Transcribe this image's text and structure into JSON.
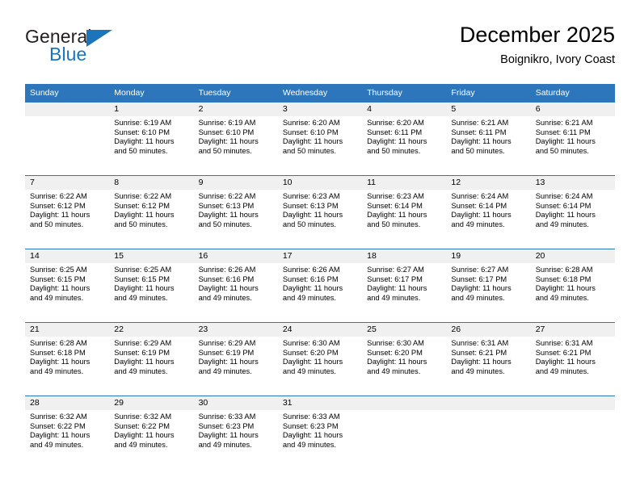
{
  "brand": {
    "name_part1": "General",
    "name_part2": "Blue",
    "triangle_color": "#1b75bb"
  },
  "header": {
    "month_title": "December 2025",
    "location": "Boignikro, Ivory Coast"
  },
  "theme": {
    "header_blue": "#2d76bb",
    "daynum_band": "#f0f0f0",
    "text": "#000000"
  },
  "calendar": {
    "weekday_headers": [
      "Sunday",
      "Monday",
      "Tuesday",
      "Wednesday",
      "Thursday",
      "Friday",
      "Saturday"
    ],
    "weeks": [
      [
        {
          "day": "",
          "sunrise": "",
          "sunset": "",
          "daylight_line1": "",
          "daylight_line2": "",
          "empty": true
        },
        {
          "day": "1",
          "sunrise": "Sunrise: 6:19 AM",
          "sunset": "Sunset: 6:10 PM",
          "daylight_line1": "Daylight: 11 hours",
          "daylight_line2": "and 50 minutes.",
          "empty": false
        },
        {
          "day": "2",
          "sunrise": "Sunrise: 6:19 AM",
          "sunset": "Sunset: 6:10 PM",
          "daylight_line1": "Daylight: 11 hours",
          "daylight_line2": "and 50 minutes.",
          "empty": false
        },
        {
          "day": "3",
          "sunrise": "Sunrise: 6:20 AM",
          "sunset": "Sunset: 6:10 PM",
          "daylight_line1": "Daylight: 11 hours",
          "daylight_line2": "and 50 minutes.",
          "empty": false
        },
        {
          "day": "4",
          "sunrise": "Sunrise: 6:20 AM",
          "sunset": "Sunset: 6:11 PM",
          "daylight_line1": "Daylight: 11 hours",
          "daylight_line2": "and 50 minutes.",
          "empty": false
        },
        {
          "day": "5",
          "sunrise": "Sunrise: 6:21 AM",
          "sunset": "Sunset: 6:11 PM",
          "daylight_line1": "Daylight: 11 hours",
          "daylight_line2": "and 50 minutes.",
          "empty": false
        },
        {
          "day": "6",
          "sunrise": "Sunrise: 6:21 AM",
          "sunset": "Sunset: 6:11 PM",
          "daylight_line1": "Daylight: 11 hours",
          "daylight_line2": "and 50 minutes.",
          "empty": false
        }
      ],
      [
        {
          "day": "7",
          "sunrise": "Sunrise: 6:22 AM",
          "sunset": "Sunset: 6:12 PM",
          "daylight_line1": "Daylight: 11 hours",
          "daylight_line2": "and 50 minutes.",
          "empty": false
        },
        {
          "day": "8",
          "sunrise": "Sunrise: 6:22 AM",
          "sunset": "Sunset: 6:12 PM",
          "daylight_line1": "Daylight: 11 hours",
          "daylight_line2": "and 50 minutes.",
          "empty": false
        },
        {
          "day": "9",
          "sunrise": "Sunrise: 6:22 AM",
          "sunset": "Sunset: 6:13 PM",
          "daylight_line1": "Daylight: 11 hours",
          "daylight_line2": "and 50 minutes.",
          "empty": false
        },
        {
          "day": "10",
          "sunrise": "Sunrise: 6:23 AM",
          "sunset": "Sunset: 6:13 PM",
          "daylight_line1": "Daylight: 11 hours",
          "daylight_line2": "and 50 minutes.",
          "empty": false
        },
        {
          "day": "11",
          "sunrise": "Sunrise: 6:23 AM",
          "sunset": "Sunset: 6:14 PM",
          "daylight_line1": "Daylight: 11 hours",
          "daylight_line2": "and 50 minutes.",
          "empty": false
        },
        {
          "day": "12",
          "sunrise": "Sunrise: 6:24 AM",
          "sunset": "Sunset: 6:14 PM",
          "daylight_line1": "Daylight: 11 hours",
          "daylight_line2": "and 49 minutes.",
          "empty": false
        },
        {
          "day": "13",
          "sunrise": "Sunrise: 6:24 AM",
          "sunset": "Sunset: 6:14 PM",
          "daylight_line1": "Daylight: 11 hours",
          "daylight_line2": "and 49 minutes.",
          "empty": false
        }
      ],
      [
        {
          "day": "14",
          "sunrise": "Sunrise: 6:25 AM",
          "sunset": "Sunset: 6:15 PM",
          "daylight_line1": "Daylight: 11 hours",
          "daylight_line2": "and 49 minutes.",
          "empty": false
        },
        {
          "day": "15",
          "sunrise": "Sunrise: 6:25 AM",
          "sunset": "Sunset: 6:15 PM",
          "daylight_line1": "Daylight: 11 hours",
          "daylight_line2": "and 49 minutes.",
          "empty": false
        },
        {
          "day": "16",
          "sunrise": "Sunrise: 6:26 AM",
          "sunset": "Sunset: 6:16 PM",
          "daylight_line1": "Daylight: 11 hours",
          "daylight_line2": "and 49 minutes.",
          "empty": false
        },
        {
          "day": "17",
          "sunrise": "Sunrise: 6:26 AM",
          "sunset": "Sunset: 6:16 PM",
          "daylight_line1": "Daylight: 11 hours",
          "daylight_line2": "and 49 minutes.",
          "empty": false
        },
        {
          "day": "18",
          "sunrise": "Sunrise: 6:27 AM",
          "sunset": "Sunset: 6:17 PM",
          "daylight_line1": "Daylight: 11 hours",
          "daylight_line2": "and 49 minutes.",
          "empty": false
        },
        {
          "day": "19",
          "sunrise": "Sunrise: 6:27 AM",
          "sunset": "Sunset: 6:17 PM",
          "daylight_line1": "Daylight: 11 hours",
          "daylight_line2": "and 49 minutes.",
          "empty": false
        },
        {
          "day": "20",
          "sunrise": "Sunrise: 6:28 AM",
          "sunset": "Sunset: 6:18 PM",
          "daylight_line1": "Daylight: 11 hours",
          "daylight_line2": "and 49 minutes.",
          "empty": false
        }
      ],
      [
        {
          "day": "21",
          "sunrise": "Sunrise: 6:28 AM",
          "sunset": "Sunset: 6:18 PM",
          "daylight_line1": "Daylight: 11 hours",
          "daylight_line2": "and 49 minutes.",
          "empty": false
        },
        {
          "day": "22",
          "sunrise": "Sunrise: 6:29 AM",
          "sunset": "Sunset: 6:19 PM",
          "daylight_line1": "Daylight: 11 hours",
          "daylight_line2": "and 49 minutes.",
          "empty": false
        },
        {
          "day": "23",
          "sunrise": "Sunrise: 6:29 AM",
          "sunset": "Sunset: 6:19 PM",
          "daylight_line1": "Daylight: 11 hours",
          "daylight_line2": "and 49 minutes.",
          "empty": false
        },
        {
          "day": "24",
          "sunrise": "Sunrise: 6:30 AM",
          "sunset": "Sunset: 6:20 PM",
          "daylight_line1": "Daylight: 11 hours",
          "daylight_line2": "and 49 minutes.",
          "empty": false
        },
        {
          "day": "25",
          "sunrise": "Sunrise: 6:30 AM",
          "sunset": "Sunset: 6:20 PM",
          "daylight_line1": "Daylight: 11 hours",
          "daylight_line2": "and 49 minutes.",
          "empty": false
        },
        {
          "day": "26",
          "sunrise": "Sunrise: 6:31 AM",
          "sunset": "Sunset: 6:21 PM",
          "daylight_line1": "Daylight: 11 hours",
          "daylight_line2": "and 49 minutes.",
          "empty": false
        },
        {
          "day": "27",
          "sunrise": "Sunrise: 6:31 AM",
          "sunset": "Sunset: 6:21 PM",
          "daylight_line1": "Daylight: 11 hours",
          "daylight_line2": "and 49 minutes.",
          "empty": false
        }
      ],
      [
        {
          "day": "28",
          "sunrise": "Sunrise: 6:32 AM",
          "sunset": "Sunset: 6:22 PM",
          "daylight_line1": "Daylight: 11 hours",
          "daylight_line2": "and 49 minutes.",
          "empty": false
        },
        {
          "day": "29",
          "sunrise": "Sunrise: 6:32 AM",
          "sunset": "Sunset: 6:22 PM",
          "daylight_line1": "Daylight: 11 hours",
          "daylight_line2": "and 49 minutes.",
          "empty": false
        },
        {
          "day": "30",
          "sunrise": "Sunrise: 6:33 AM",
          "sunset": "Sunset: 6:23 PM",
          "daylight_line1": "Daylight: 11 hours",
          "daylight_line2": "and 49 minutes.",
          "empty": false
        },
        {
          "day": "31",
          "sunrise": "Sunrise: 6:33 AM",
          "sunset": "Sunset: 6:23 PM",
          "daylight_line1": "Daylight: 11 hours",
          "daylight_line2": "and 49 minutes.",
          "empty": false
        },
        {
          "day": "",
          "sunrise": "",
          "sunset": "",
          "daylight_line1": "",
          "daylight_line2": "",
          "empty": true
        },
        {
          "day": "",
          "sunrise": "",
          "sunset": "",
          "daylight_line1": "",
          "daylight_line2": "",
          "empty": true
        },
        {
          "day": "",
          "sunrise": "",
          "sunset": "",
          "daylight_line1": "",
          "daylight_line2": "",
          "empty": true
        }
      ]
    ]
  }
}
